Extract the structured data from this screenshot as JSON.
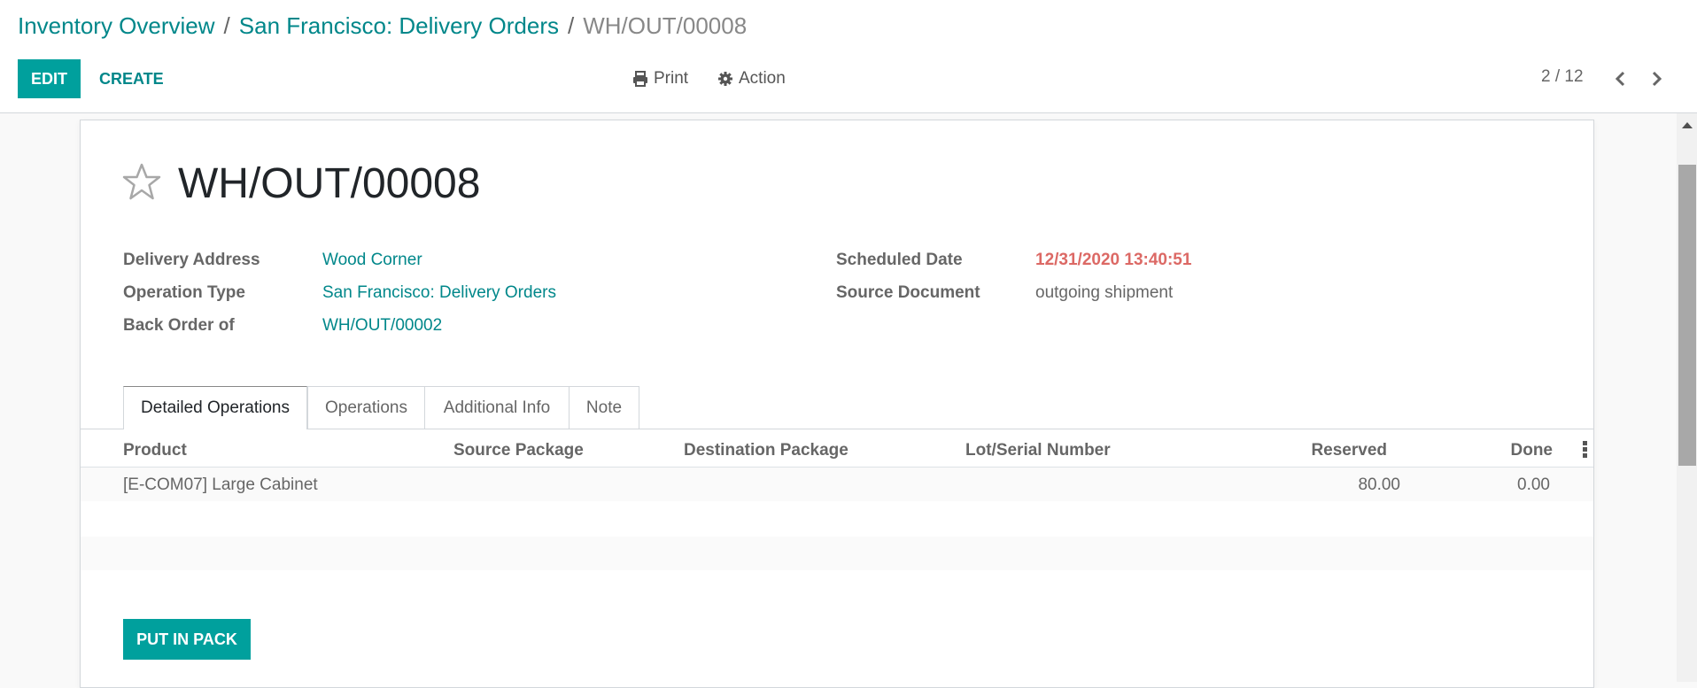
{
  "breadcrumb": {
    "items": [
      "Inventory Overview",
      "San Francisco: Delivery Orders"
    ],
    "current": "WH/OUT/00008",
    "separator": "/"
  },
  "toolbar": {
    "edit_label": "EDIT",
    "create_label": "CREATE",
    "print_label": "Print",
    "action_label": "Action",
    "pager": "2 / 12"
  },
  "record": {
    "title": "WH/OUT/00008",
    "fields_left": [
      {
        "label": "Delivery Address",
        "value": "Wood Corner"
      },
      {
        "label": "Operation Type",
        "value": "San Francisco: Delivery Orders"
      },
      {
        "label": "Back Order of",
        "value": "WH/OUT/00002"
      }
    ],
    "fields_right": [
      {
        "label": "Scheduled Date",
        "value": "12/31/2020 13:40:51"
      },
      {
        "label": "Source Document",
        "value": "outgoing shipment"
      }
    ]
  },
  "tabs": [
    "Detailed Operations",
    "Operations",
    "Additional Info",
    "Note"
  ],
  "table": {
    "columns": [
      "Product",
      "Source Package",
      "Destination Package",
      "Lot/Serial Number",
      "Reserved",
      "Done"
    ],
    "rows": [
      {
        "product": "[E-COM07] Large Cabinet",
        "source_package": "",
        "destination_package": "",
        "lot": "",
        "reserved": "80.00",
        "done": "0.00"
      }
    ]
  },
  "footer": {
    "put_in_pack_label": "PUT IN PACK"
  },
  "colors": {
    "primary": "#00a09d",
    "link": "#00878a",
    "danger": "#dc6965"
  }
}
